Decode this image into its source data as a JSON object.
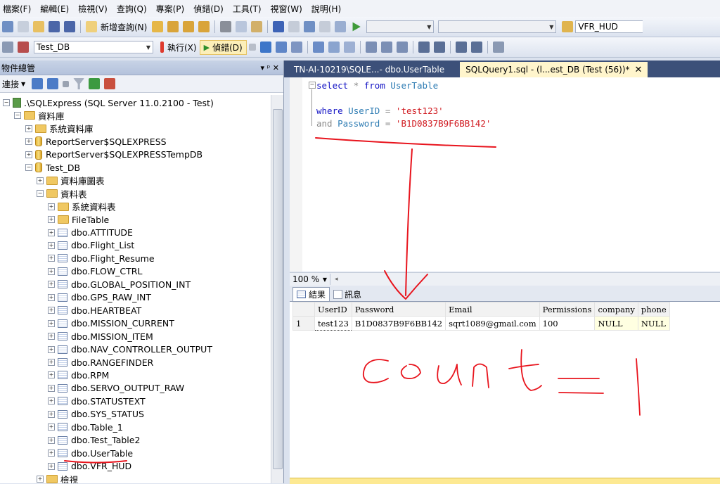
{
  "menu": [
    "檔案(F)",
    "編輯(E)",
    "檢視(V)",
    "查詢(Q)",
    "專案(P)",
    "偵錯(D)",
    "工具(T)",
    "視窗(W)",
    "說明(H)"
  ],
  "toolbar1": {
    "new_query_label": "新增查詢(N)",
    "search_value": "VFR_HUD"
  },
  "toolbar2": {
    "database_value": "Test_DB",
    "execute_label": "執行(X)",
    "debug_label": "偵錯(D)"
  },
  "object_explorer": {
    "title": "物件總管",
    "title_controls": "▾ ᵖ ✕",
    "connect_label": "連接",
    "tree": [
      {
        "expander": "−",
        "icon": "server",
        "label": ".\\SQLExpress (SQL Server 11.0.2100 - Test)"
      },
      {
        "expander": "−",
        "icon": "folder",
        "label": "資料庫"
      },
      {
        "expander": "+",
        "icon": "folder",
        "label": "系統資料庫"
      },
      {
        "expander": "+",
        "icon": "db",
        "label": "ReportServer$SQLEXPRESS"
      },
      {
        "expander": "+",
        "icon": "db",
        "label": "ReportServer$SQLEXPRESSTempDB"
      },
      {
        "expander": "−",
        "icon": "db",
        "label": "Test_DB"
      },
      {
        "expander": "+",
        "icon": "folder",
        "label": "資料庫圖表"
      },
      {
        "expander": "−",
        "icon": "folder",
        "label": "資料表"
      },
      {
        "expander": "+",
        "icon": "folder",
        "label": "系統資料表"
      },
      {
        "expander": "+",
        "icon": "folder",
        "label": "FileTable"
      },
      {
        "expander": "+",
        "icon": "table",
        "label": "dbo.ATTITUDE"
      },
      {
        "expander": "+",
        "icon": "table",
        "label": "dbo.Flight_List"
      },
      {
        "expander": "+",
        "icon": "table",
        "label": "dbo.Flight_Resume"
      },
      {
        "expander": "+",
        "icon": "table",
        "label": "dbo.FLOW_CTRL"
      },
      {
        "expander": "+",
        "icon": "table",
        "label": "dbo.GLOBAL_POSITION_INT"
      },
      {
        "expander": "+",
        "icon": "table",
        "label": "dbo.GPS_RAW_INT"
      },
      {
        "expander": "+",
        "icon": "table",
        "label": "dbo.HEARTBEAT"
      },
      {
        "expander": "+",
        "icon": "table",
        "label": "dbo.MISSION_CURRENT"
      },
      {
        "expander": "+",
        "icon": "table",
        "label": "dbo.MISSION_ITEM"
      },
      {
        "expander": "+",
        "icon": "table",
        "label": "dbo.NAV_CONTROLLER_OUTPUT"
      },
      {
        "expander": "+",
        "icon": "table",
        "label": "dbo.RANGEFINDER"
      },
      {
        "expander": "+",
        "icon": "table",
        "label": "dbo.RPM"
      },
      {
        "expander": "+",
        "icon": "table",
        "label": "dbo.SERVO_OUTPUT_RAW"
      },
      {
        "expander": "+",
        "icon": "table",
        "label": "dbo.STATUSTEXT"
      },
      {
        "expander": "+",
        "icon": "table",
        "label": "dbo.SYS_STATUS"
      },
      {
        "expander": "+",
        "icon": "table",
        "label": "dbo.Table_1"
      },
      {
        "expander": "+",
        "icon": "table",
        "label": "dbo.Test_Table2"
      },
      {
        "expander": "+",
        "icon": "table",
        "label": "dbo.UserTable"
      },
      {
        "expander": "+",
        "icon": "table",
        "label": "dbo.VFR_HUD"
      },
      {
        "expander": "+",
        "icon": "folder",
        "label": "檢視"
      }
    ]
  },
  "tabs": [
    {
      "label": "TN-AI-10219\\SQLE...- dbo.UserTable",
      "active": false
    },
    {
      "label": "SQLQuery1.sql - (l...est_DB (Test (56))*",
      "active": true,
      "close": "✕"
    }
  ],
  "query": {
    "line1": {
      "kw1": "select",
      "op": "*",
      "kw2": "from",
      "id": "UserTable"
    },
    "line3": {
      "kw": "where",
      "id": "UserID",
      "op": "=",
      "str": "'test123'"
    },
    "line4": {
      "kw": "and",
      "id": "Password",
      "op": "=",
      "str": "'B1D0837B9F6BB142'"
    }
  },
  "zoom": "100 %",
  "result_tabs": [
    "結果",
    "訊息"
  ],
  "results": {
    "columns": [
      "UserID",
      "Password",
      "Email",
      "Permissions",
      "company",
      "phone"
    ],
    "rows": [
      {
        "num": "1",
        "cells": [
          "test123",
          "B1D0837B9F6BB142",
          "sqrt1089@gmail.com",
          "100",
          "NULL",
          "NULL"
        ]
      }
    ]
  },
  "annotation": {
    "text": "count = 1",
    "color": "#e8141d"
  }
}
